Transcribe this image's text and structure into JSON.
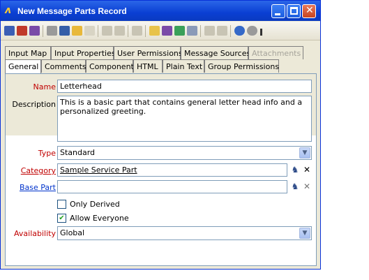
{
  "window": {
    "title": "New Message Parts Record"
  },
  "toolbar": {
    "icons": [
      "save-icon",
      "save-close-icon",
      "save-new-icon",
      "print-icon",
      "find-icon",
      "open-folder-icon",
      "list-icon",
      "forward-icon",
      "delete-icon",
      "record-icon",
      "copy-icon",
      "copy-window-icon",
      "refresh-icon",
      "settings-icon",
      "insert-icon",
      "attach-icon",
      "help-icon",
      "info-icon"
    ]
  },
  "tabs": {
    "row1": [
      "Input Map",
      "Input Properties",
      "User Permissions",
      "Message Sources",
      "Attachments"
    ],
    "row2": [
      "General",
      "Comments",
      "Component",
      "HTML",
      "Plain Text",
      "Group Permissions"
    ]
  },
  "form": {
    "name_label": "Name",
    "name_value": "Letterhead",
    "description_label": "Description",
    "description_value": "This is a basic part that contains general letter head info and a personalized greeting.",
    "type_label": "Type",
    "type_value": "Standard",
    "category_label": "Category",
    "category_value": "Sample Service Part",
    "base_part_label": "Base Part",
    "base_part_value": "",
    "only_derived_label": "Only Derived",
    "only_derived_checked": false,
    "allow_everyone_label": "Allow Everyone",
    "allow_everyone_checked": true,
    "availability_label": "Availability",
    "availability_value": "Global"
  }
}
